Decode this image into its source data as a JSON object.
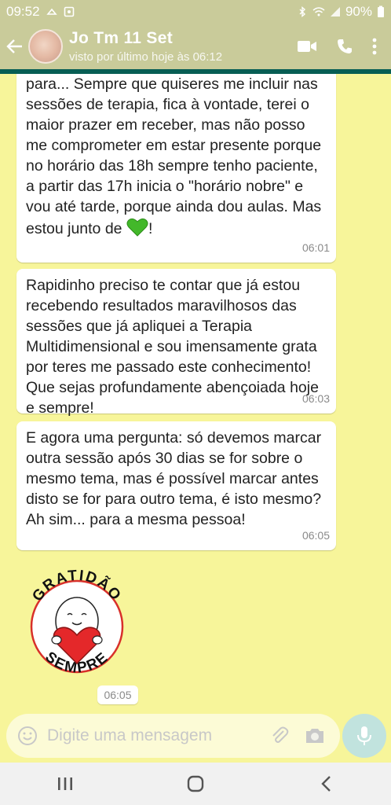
{
  "status_bar": {
    "time": "09:52",
    "battery": "90%"
  },
  "header": {
    "contact_name": "Jo Tm 11 Set",
    "last_seen": "visto por último hoje às 06:12"
  },
  "messages": [
    {
      "text": "para... Sempre que quiseres me incluir nas sessões de terapia, fica à vontade, terei o maior prazer em receber, mas não posso me comprometer em estar presente porque no horário das 18h sempre tenho paciente, a partir das 17h inicia o \"horário nobre\" e vou até tarde, porque ainda dou aulas. Mas estou junto de",
      "text_end": "!",
      "time": "06:01"
    },
    {
      "text": "Rapidinho preciso te contar que já estou recebendo resultados maravilhosos das sessões que já apliquei a Terapia Multidimensional e sou imensamente grata por teres me passado este conhecimento! Que sejas profundamente abençoiada hoje e sempre!",
      "time": "06:03"
    },
    {
      "text": "E agora uma pergunta: só devemos marcar outra sessão após 30 dias se for sobre o mesmo tema, mas é possível marcar antes disto se for para outro tema, é isto mesmo? Ah sim... para a mesma pessoa!",
      "time": "06:05"
    }
  ],
  "sticker": {
    "top_text": "GRATIDÃO",
    "bottom_text": "SEMPRE",
    "time": "06:05"
  },
  "input": {
    "placeholder": "Digite uma mensagem"
  },
  "colors": {
    "chat_bg": "#f7f59a",
    "header_bg": "#c9cb9a",
    "accent": "#075e54",
    "mic_bg": "#c1e3de"
  }
}
